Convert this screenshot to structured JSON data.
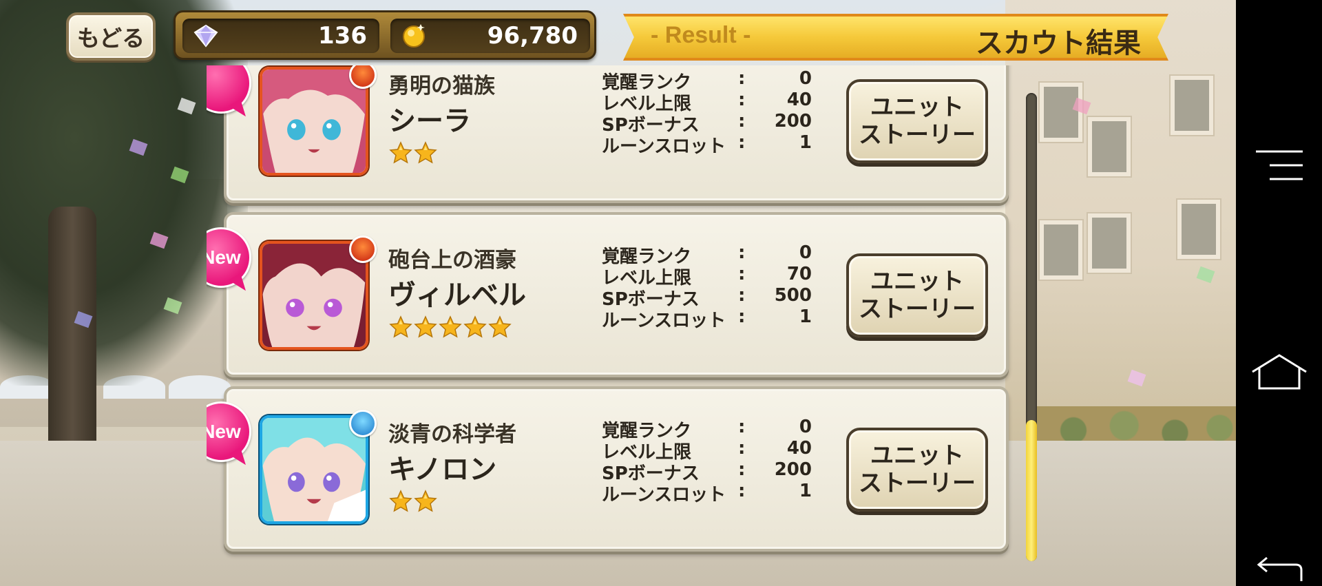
{
  "header": {
    "back_label": "もどる",
    "gems": "136",
    "coins": "96,780",
    "result_en": "- Result -",
    "result_jp": "スカウト結果"
  },
  "units": [
    {
      "is_new": true,
      "new_label": "",
      "title": "勇明の猫族",
      "name": "シーラ",
      "element": "fire",
      "stars": 2,
      "frame_color": "#e4541e",
      "stats": [
        {
          "label": "覚醒ランク",
          "value": "0"
        },
        {
          "label": "レベル上限",
          "value": "40"
        },
        {
          "label": "SPボーナス",
          "value": "200"
        },
        {
          "label": "ルーンスロット",
          "value": "1"
        }
      ],
      "story_line1": "ユニット",
      "story_line2": "ストーリー"
    },
    {
      "is_new": true,
      "new_label": "New",
      "title": "砲台上の酒豪",
      "name": "ヴィルベル",
      "element": "fire",
      "stars": 5,
      "frame_color": "#e4541e",
      "stats": [
        {
          "label": "覚醒ランク",
          "value": "0"
        },
        {
          "label": "レベル上限",
          "value": "70"
        },
        {
          "label": "SPボーナス",
          "value": "500"
        },
        {
          "label": "ルーンスロット",
          "value": "1"
        }
      ],
      "story_line1": "ユニット",
      "story_line2": "ストーリー"
    },
    {
      "is_new": true,
      "new_label": "New",
      "title": "淡青の科学者",
      "name": "キノロン",
      "element": "water",
      "stars": 2,
      "frame_color": "#1ea6e4",
      "stats": [
        {
          "label": "覚醒ランク",
          "value": "0"
        },
        {
          "label": "レベル上限",
          "value": "40"
        },
        {
          "label": "SPボーナス",
          "value": "200"
        },
        {
          "label": "ルーンスロット",
          "value": "1"
        }
      ],
      "story_line1": "ユニット",
      "story_line2": "ストーリー"
    }
  ],
  "stat_colon": ":",
  "scroll": {
    "position_fraction": 0.7
  },
  "colors": {
    "accent_gold": "#f5c93a",
    "new_pink": "#e9177b",
    "panel": "#f6f3e8"
  },
  "icons": {
    "gem": "diamond-icon",
    "coin": "gold-coin-icon",
    "star": "star-icon",
    "fire": "fire-element-icon",
    "water": "water-element-icon",
    "menu": "menu-icon",
    "home": "home-icon",
    "back": "back-arrow-icon"
  }
}
